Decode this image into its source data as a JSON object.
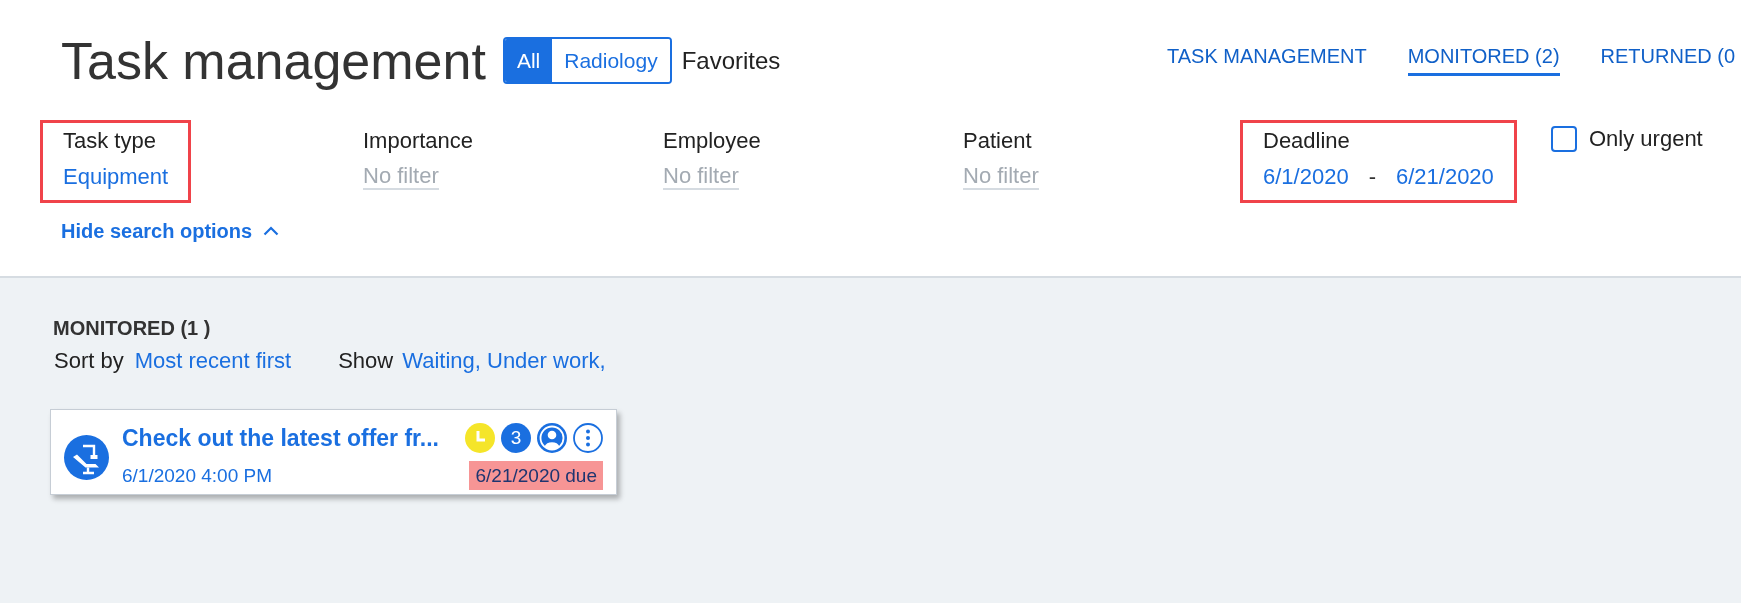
{
  "header": {
    "title": "Task management",
    "scope": [
      {
        "label": "All",
        "selected": true
      },
      {
        "label": "Radiology",
        "selected": false
      }
    ],
    "favorites": "Favorites"
  },
  "nav_tabs": [
    {
      "label": "TASK MANAGEMENT",
      "selected": false
    },
    {
      "label": "MONITORED (2)",
      "selected": true
    },
    {
      "label": "RETURNED (0",
      "selected": false
    }
  ],
  "filters": [
    {
      "kind": "select",
      "label": "Task type",
      "value": "Equipment",
      "highlighted": true
    },
    {
      "kind": "select",
      "label": "Importance",
      "placeholder": "No filter",
      "highlighted": false
    },
    {
      "kind": "select",
      "label": "Employee",
      "placeholder": "No filter",
      "highlighted": false
    },
    {
      "kind": "select",
      "label": "Patient",
      "placeholder": "No filter",
      "highlighted": false
    },
    {
      "kind": "date_range",
      "label": "Deadline",
      "from": "6/1/2020",
      "separator": "-",
      "to": "6/21/2020",
      "highlighted": true
    }
  ],
  "only_urgent": {
    "label": "Only urgent",
    "checked": false
  },
  "hide_search_options": "Hide search options",
  "list": {
    "heading": "MONITORED (1 )",
    "sort_label": "Sort by",
    "sort_value": "Most recent first",
    "show_label": "Show",
    "show_value": "Waiting, Under work,"
  },
  "tasks": [
    {
      "title": "Check out the latest offer fr...",
      "created": "6/1/2020 4:00 PM",
      "count": "3",
      "due": "6/21/2020 due",
      "overdue": true
    }
  ]
}
